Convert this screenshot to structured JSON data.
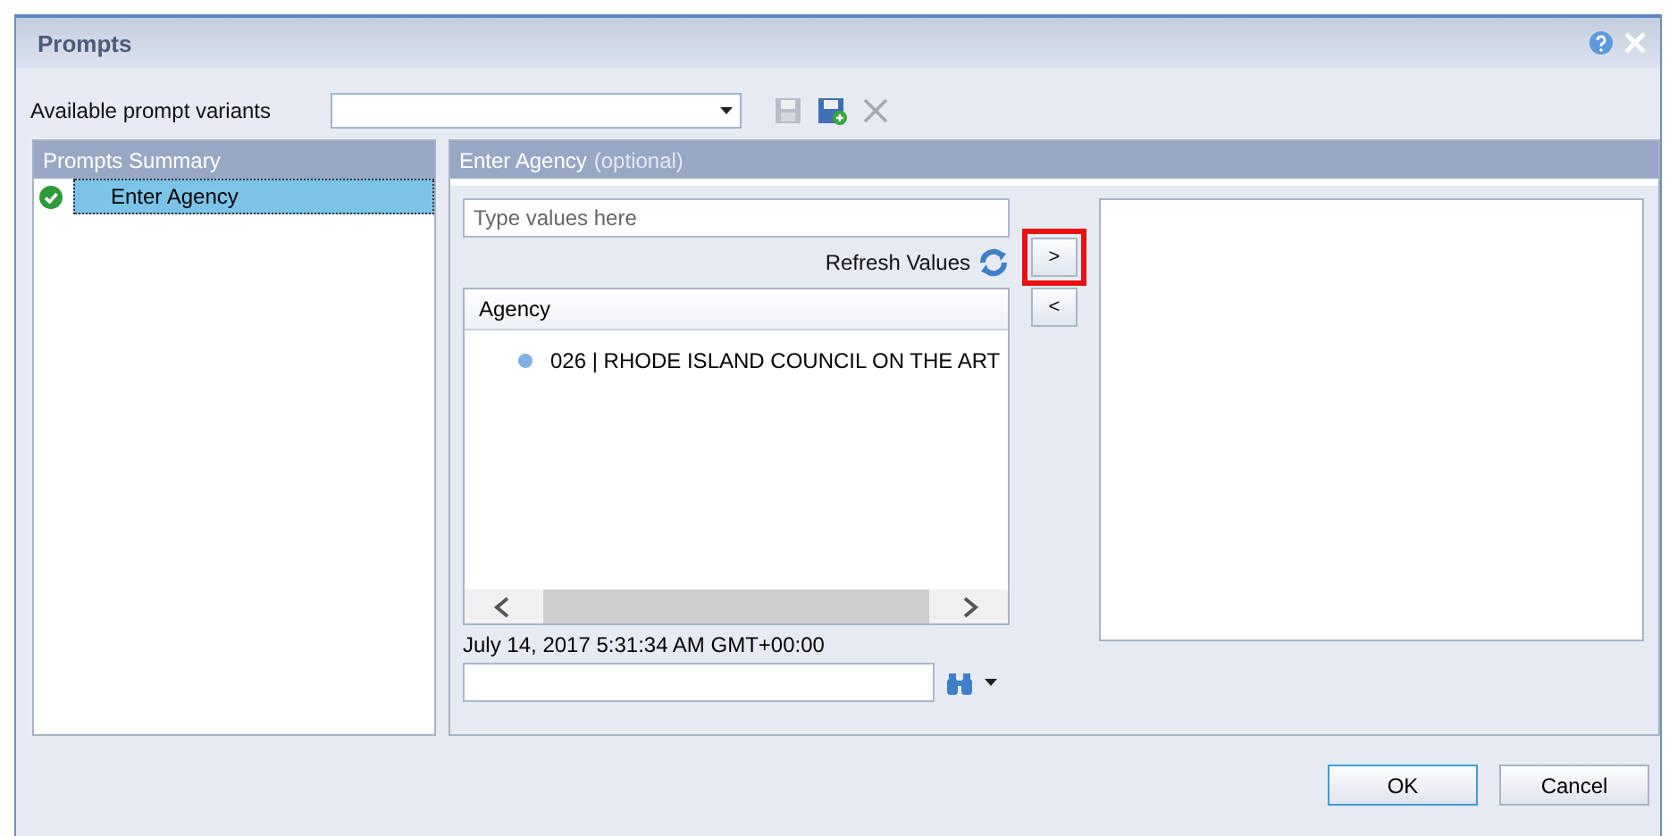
{
  "window": {
    "title": "Prompts"
  },
  "variants": {
    "label": "Available prompt variants",
    "save_disabled": true,
    "delete_disabled": true
  },
  "summary": {
    "title": "Prompts Summary",
    "items": [
      {
        "label": "Enter Agency",
        "done": true,
        "selected": true
      }
    ]
  },
  "prompt": {
    "title": "Enter Agency",
    "note": "(optional)",
    "search_placeholder": "Type values here",
    "refresh_label": "Refresh Values",
    "column": "Agency",
    "values": [
      {
        "text": "026 | RHODE ISLAND COUNCIL ON THE ART"
      }
    ],
    "timestamp": "July 14, 2017 5:31:34 AM GMT+00:00"
  },
  "move_buttons": [
    {
      "label": ">",
      "highlighted": true
    },
    {
      "label": "<",
      "highlighted": false
    }
  ],
  "footer_buttons": [
    {
      "label": "OK",
      "default": true
    },
    {
      "label": "Cancel",
      "default": false
    }
  ]
}
